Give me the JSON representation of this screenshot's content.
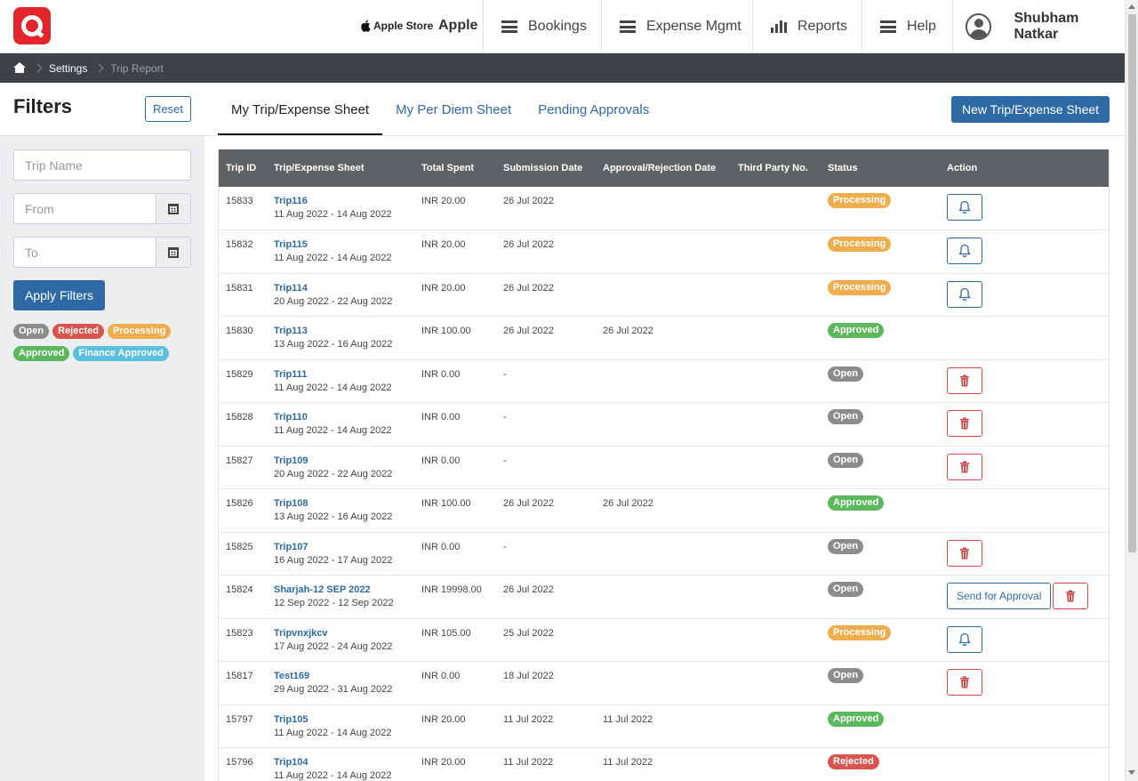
{
  "colors": {
    "brand_red": "#e4252b",
    "primary_blue": "#2d6aa5",
    "open": "#8c8c8c",
    "rejected": "#d9534f",
    "processing": "#f0ad4e",
    "approved": "#5cb85c",
    "finance_approved": "#5bc0de"
  },
  "header": {
    "store_label": "Apple Store",
    "company": "Apple",
    "nav": {
      "bookings": "Bookings",
      "expense": "Expense Mgmt",
      "reports": "Reports",
      "help": "Help"
    },
    "user_name": "Shubham Natkar"
  },
  "breadcrumb": {
    "settings": "Settings",
    "current": "Trip Report"
  },
  "sidebar": {
    "title": "Filters",
    "reset_label": "Reset",
    "trip_name_placeholder": "Trip Name",
    "from_placeholder": "From",
    "to_placeholder": "To",
    "apply_label": "Apply Filters",
    "legend": [
      {
        "label": "Open",
        "status": "open"
      },
      {
        "label": "Rejected",
        "status": "rejected"
      },
      {
        "label": "Processing",
        "status": "processing"
      },
      {
        "label": "Approved",
        "status": "approved"
      },
      {
        "label": "Finance Approved",
        "status": "finance_approved"
      }
    ]
  },
  "main": {
    "tabs": [
      "My Trip/Expense Sheet",
      "My Per Diem Sheet",
      "Pending Approvals"
    ],
    "active_tab": 0,
    "new_button": "New Trip/Expense Sheet",
    "send_label": "Send for Approval",
    "columns": [
      "Trip ID",
      "Trip/Expense Sheet",
      "Total Spent",
      "Submission Date",
      "Approval/Rejection Date",
      "Third Party No.",
      "Status",
      "Action"
    ],
    "rows": [
      {
        "id": "15833",
        "name": "Trip116",
        "dates": "11 Aug 2022 - 14 Aug 2022",
        "spent": "INR 20.00",
        "submitted": "26 Jul 2022",
        "approved": "",
        "third": "",
        "status": "Processing",
        "status_key": "processing",
        "actions": [
          "bell"
        ]
      },
      {
        "id": "15832",
        "name": "Trip115",
        "dates": "11 Aug 2022 - 14 Aug 2022",
        "spent": "INR 20.00",
        "submitted": "26 Jul 2022",
        "approved": "",
        "third": "",
        "status": "Processing",
        "status_key": "processing",
        "actions": [
          "bell"
        ]
      },
      {
        "id": "15831",
        "name": "Trip114",
        "dates": "20 Aug 2022 - 22 Aug 2022",
        "spent": "INR 20.00",
        "submitted": "26 Jul 2022",
        "approved": "",
        "third": "",
        "status": "Processing",
        "status_key": "processing",
        "actions": [
          "bell"
        ]
      },
      {
        "id": "15830",
        "name": "Trip113",
        "dates": "13 Aug 2022 - 16 Aug 2022",
        "spent": "INR 100.00",
        "submitted": "26 Jul 2022",
        "approved": "26 Jul 2022",
        "third": "",
        "status": "Approved",
        "status_key": "approved",
        "actions": []
      },
      {
        "id": "15829",
        "name": "Trip111",
        "dates": "11 Aug 2022 - 14 Aug 2022",
        "spent": "INR 0.00",
        "submitted": "-",
        "approved": "",
        "third": "",
        "status": "Open",
        "status_key": "open",
        "actions": [
          "trash"
        ]
      },
      {
        "id": "15828",
        "name": "Trip110",
        "dates": "11 Aug 2022 - 14 Aug 2022",
        "spent": "INR 0.00",
        "submitted": "-",
        "approved": "",
        "third": "",
        "status": "Open",
        "status_key": "open",
        "actions": [
          "trash"
        ]
      },
      {
        "id": "15827",
        "name": "Trip109",
        "dates": "20 Aug 2022 - 22 Aug 2022",
        "spent": "INR 0.00",
        "submitted": "-",
        "approved": "",
        "third": "",
        "status": "Open",
        "status_key": "open",
        "actions": [
          "trash"
        ]
      },
      {
        "id": "15826",
        "name": "Trip108",
        "dates": "13 Aug 2022 - 16 Aug 2022",
        "spent": "INR 100.00",
        "submitted": "26 Jul 2022",
        "approved": "26 Jul 2022",
        "third": "",
        "status": "Approved",
        "status_key": "approved",
        "actions": []
      },
      {
        "id": "15825",
        "name": "Trip107",
        "dates": "16 Aug 2022 - 17 Aug 2022",
        "spent": "INR 0.00",
        "submitted": "-",
        "approved": "",
        "third": "",
        "status": "Open",
        "status_key": "open",
        "actions": [
          "trash"
        ]
      },
      {
        "id": "15824",
        "name": "Sharjah-12 SEP 2022",
        "dates": "12 Sep 2022 - 12 Sep 2022",
        "spent": "INR 19998.00",
        "submitted": "26 Jul 2022",
        "approved": "",
        "third": "",
        "status": "Open",
        "status_key": "open",
        "actions": [
          "send",
          "trash"
        ]
      },
      {
        "id": "15823",
        "name": "Tripvnxjkcv",
        "dates": "17 Aug 2022 - 24 Aug 2022",
        "spent": "INR 105.00",
        "submitted": "25 Jul 2022",
        "approved": "",
        "third": "",
        "status": "Processing",
        "status_key": "processing",
        "actions": [
          "bell"
        ]
      },
      {
        "id": "15817",
        "name": "Test169",
        "dates": "29 Aug 2022 - 31 Aug 2022",
        "spent": "INR 0.00",
        "submitted": "18 Jul 2022",
        "approved": "",
        "third": "",
        "status": "Open",
        "status_key": "open",
        "actions": [
          "trash"
        ]
      },
      {
        "id": "15797",
        "name": "Trip105",
        "dates": "11 Aug 2022 - 14 Aug 2022",
        "spent": "INR 20.00",
        "submitted": "11 Jul 2022",
        "approved": "11 Jul 2022",
        "third": "",
        "status": "Approved",
        "status_key": "approved",
        "actions": []
      },
      {
        "id": "15796",
        "name": "Trip104",
        "dates": "11 Aug 2022 - 14 Aug 2022",
        "spent": "INR 20.00",
        "submitted": "11 Jul 2022",
        "approved": "11 Jul 2022",
        "third": "",
        "status": "Rejected",
        "status_key": "rejected",
        "actions": []
      }
    ]
  }
}
